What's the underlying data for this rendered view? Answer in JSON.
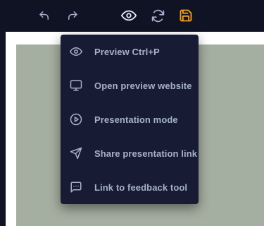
{
  "toolbar": {
    "buttons": [
      {
        "icon": "undo-icon"
      },
      {
        "icon": "redo-icon"
      },
      {
        "icon": "eye-icon"
      },
      {
        "icon": "sync-icon"
      },
      {
        "icon": "save-icon"
      }
    ]
  },
  "menu": {
    "items": [
      {
        "label": "Preview Ctrl+P",
        "icon": "eye-icon"
      },
      {
        "label": "Open preview website",
        "icon": "monitor-icon"
      },
      {
        "label": "Presentation mode",
        "icon": "play-circle-icon"
      },
      {
        "label": "Share presentation link",
        "icon": "send-icon"
      },
      {
        "label": "Link to feedback tool",
        "icon": "message-icon"
      }
    ]
  },
  "colors": {
    "toolbar_bg": "#0f1324",
    "icon": "#a7b1cc",
    "save_accent": "#f4a21b",
    "menu_bg": "#171b33",
    "canvas_bg": "#a5afa1"
  }
}
